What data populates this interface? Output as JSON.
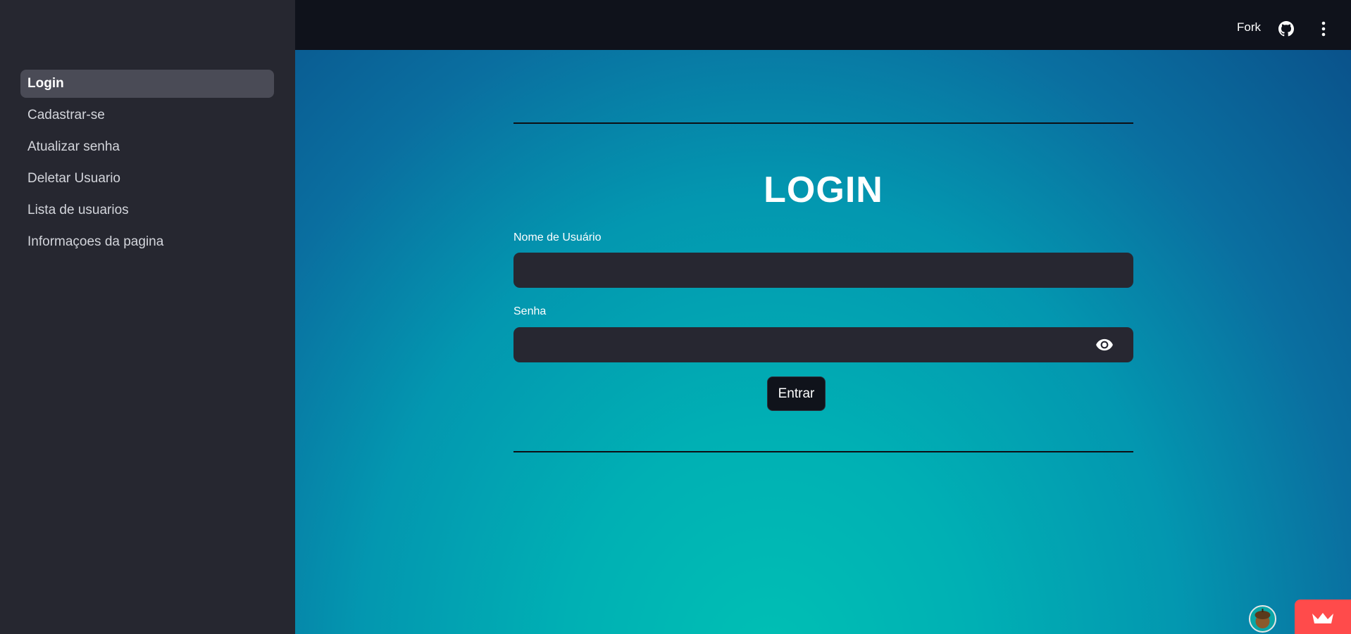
{
  "sidebar": {
    "items": [
      {
        "label": "Login"
      },
      {
        "label": "Cadastrar-se"
      },
      {
        "label": "Atualizar senha"
      },
      {
        "label": "Deletar Usuario"
      },
      {
        "label": "Lista de usuarios"
      },
      {
        "label": "Informaçoes da pagina"
      }
    ],
    "active_item": "Login"
  },
  "header": {
    "fork_label": "Fork",
    "icons": [
      "github-icon",
      "more-vertical-icon"
    ]
  },
  "form": {
    "title": "LOGIN",
    "username_label": "Nome de Usuário",
    "username_value": "",
    "password_label": "Senha",
    "password_value": "",
    "submit_label": "Entrar"
  },
  "footer": {
    "icons": [
      "avatar-icon",
      "crown-icon"
    ]
  },
  "colors": {
    "sidebar_bg": "#262730",
    "topbar_bg": "#0f121b",
    "input_bg": "#272731",
    "accent_red": "#ff4b4b"
  }
}
